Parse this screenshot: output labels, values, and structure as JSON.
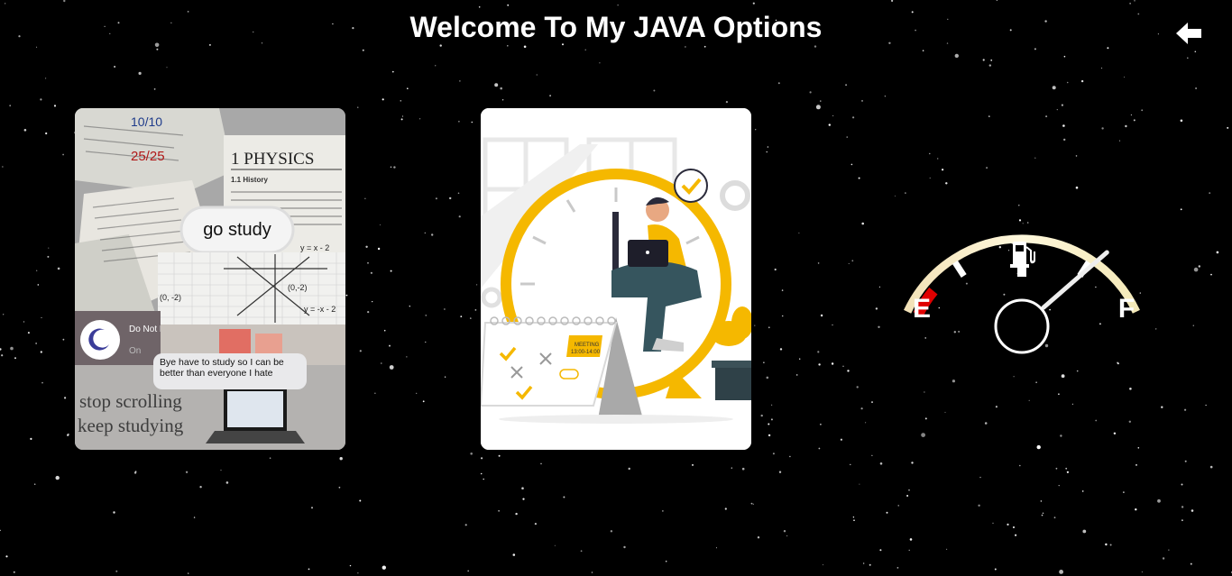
{
  "header": {
    "title": "Welcome To My JAVA Options"
  },
  "icons": {
    "back": "arrow-left-icon",
    "fuel": "fuel-pump-icon",
    "moon": "moon-icon"
  },
  "cards": {
    "study": {
      "score": "25/25",
      "date": "10/10",
      "physics": "1 PHYSICS",
      "history": "1.1 History",
      "bubble": "go study",
      "eq1": "y = x - 2",
      "eq2": "(0, -2)",
      "eq3": "(0,-2)",
      "eq4": "y = -x - 2",
      "dnd_title": "Do Not Disturb",
      "dnd_status": "On",
      "message": "Bye have to study so I can be better than everyone I hate",
      "slogan_line1": "stop scrolling",
      "slogan_line2": "keep studying"
    },
    "clock": {
      "meeting_label": "MEETING",
      "meeting_time": "13:00-14:00"
    }
  },
  "gauge": {
    "empty_label": "E",
    "full_label": "F",
    "level_fraction": 0.85
  },
  "colors": {
    "background": "#000000",
    "title": "#ffffff",
    "accent_yellow": "#F5B800",
    "gauge_empty_red": "#e00000",
    "gauge_arc": "#f8f0c8"
  }
}
